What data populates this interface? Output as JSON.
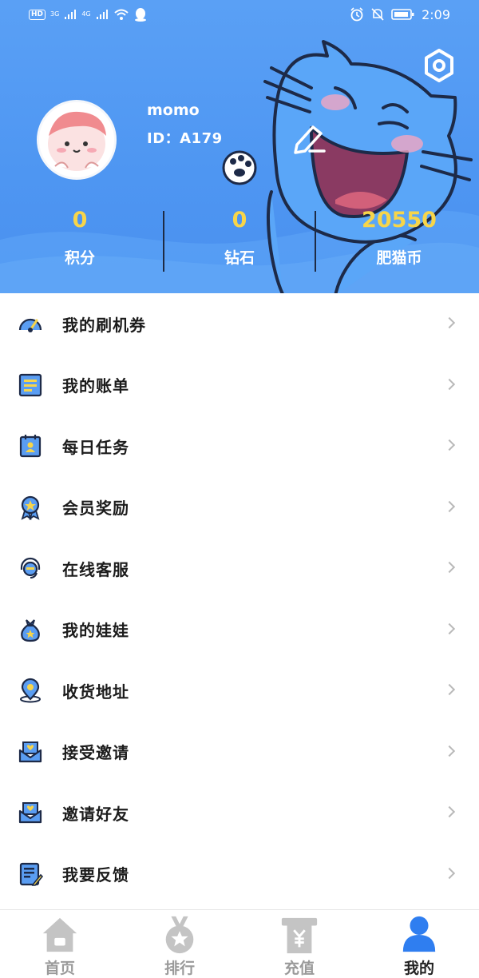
{
  "status_bar": {
    "network_chip": "HD",
    "sim1_label": "3G",
    "sim2_label": "4G",
    "time": "2:09"
  },
  "profile": {
    "nickname": "momo",
    "id_text": "ID：A179"
  },
  "stats": [
    {
      "value": "0",
      "label": "积分"
    },
    {
      "value": "0",
      "label": "钻石"
    },
    {
      "value": "20550",
      "label": "肥猫币"
    }
  ],
  "menu": [
    {
      "label": "我的刷机券",
      "icon": "gauge-icon"
    },
    {
      "label": "我的账单",
      "icon": "bill-icon"
    },
    {
      "label": "每日任务",
      "icon": "calendar-task-icon"
    },
    {
      "label": "会员奖励",
      "icon": "medal-icon"
    },
    {
      "label": "在线客服",
      "icon": "headset-icon"
    },
    {
      "label": "我的娃娃",
      "icon": "bag-icon"
    },
    {
      "label": "收货地址",
      "icon": "location-pin-icon"
    },
    {
      "label": "接受邀请",
      "icon": "envelope-heart-icon"
    },
    {
      "label": "邀请好友",
      "icon": "envelope-heart-icon"
    },
    {
      "label": "我要反馈",
      "icon": "feedback-edit-icon"
    }
  ],
  "tabs": [
    {
      "label": "首页",
      "icon": "home-icon",
      "active": false
    },
    {
      "label": "排行",
      "icon": "medal-star-icon",
      "active": false
    },
    {
      "label": "充值",
      "icon": "yuan-icon",
      "active": false
    },
    {
      "label": "我的",
      "icon": "user-icon",
      "active": true
    }
  ],
  "colors": {
    "header_blue": "#4e96f2",
    "stat_yellow": "#f7d54a",
    "tab_active": "#2f7ef0",
    "tab_inactive": "#c4c4c4"
  }
}
